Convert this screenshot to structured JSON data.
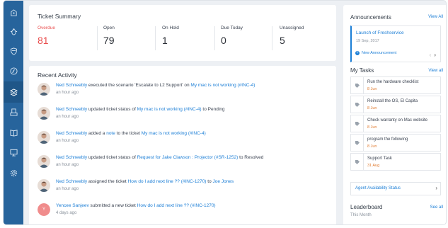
{
  "summary": {
    "title": "Ticket Summary",
    "stats": [
      {
        "label": "Overdue",
        "value": "81",
        "color": "#e94f4f"
      },
      {
        "label": "Open",
        "value": "79"
      },
      {
        "label": "On Hold",
        "value": "1"
      },
      {
        "label": "Due Today",
        "value": "0"
      },
      {
        "label": "Unassigned",
        "value": "5"
      }
    ]
  },
  "activity": {
    "title": "Recent Activity",
    "items": [
      {
        "actor": "Ned Schneebly",
        "text1": " executed the scenario 'Escalate to L2 Support' on ",
        "target": "My mac is not working (#INC-4)",
        "text2": "",
        "target2": "",
        "time": "an hour ago"
      },
      {
        "actor": "Ned Schneebly",
        "text1": " updated ticket status of ",
        "target": "My mac is not working (#INC-4)",
        "text2": " to Pending",
        "target2": "",
        "time": "an hour ago"
      },
      {
        "actor": "Ned Schneebly",
        "text1": " added a ",
        "target": "note",
        "text2": " to the ticket ",
        "target2": "My mac is not working (#INC-4)",
        "time": "an hour ago"
      },
      {
        "actor": "Ned Schneebly",
        "text1": " updated ticket status of ",
        "target": "Request for Jake Clawson : Projector (#SR-1252)",
        "text2": " to Resolved",
        "target2": "",
        "time": "an hour ago"
      },
      {
        "actor": "Ned Schneebly",
        "text1": " assigned the ticket ",
        "target": "How do I add next line ?? (#INC-1270)",
        "text2": " to ",
        "target2": "Joe Jones",
        "time": "an hour ago"
      },
      {
        "actor": "Yencee Sanjeev",
        "text1": " submitted a new ticket ",
        "target": "How do I add next line ?? (#INC-1270)",
        "text2": "",
        "target2": "",
        "time": "4 days ago",
        "initial": "Y"
      }
    ]
  },
  "announcements": {
    "title": "Announcements",
    "view_all": "View All",
    "item_title": "Launch of Freshservice",
    "item_date": "19 Sep, 2017",
    "new_label": "New Announcement"
  },
  "tasks": {
    "title": "My Tasks",
    "view_all": "View all",
    "items": [
      {
        "name": "Run the hardware checklist",
        "date": "8 Jun"
      },
      {
        "name": "Reinstall the OS, El Capita",
        "date": "8 Jun"
      },
      {
        "name": "Check warranty on Mac website",
        "date": "8 Jun"
      },
      {
        "name": "program the following",
        "date": "8 Jun"
      },
      {
        "name": "Support Task",
        "date": "31 Aug"
      }
    ]
  },
  "availability": {
    "label": "Agent Availability Status"
  },
  "leaderboard": {
    "title": "Leaderboard",
    "see_all": "See all",
    "period": "This Month"
  },
  "sidebar": {
    "icons": [
      "ticket-icon",
      "bug-icon",
      "shield-icon",
      "contact-icon",
      "layers-icon",
      "inbox-icon",
      "book-icon",
      "monitor-icon",
      "gear-icon"
    ]
  }
}
